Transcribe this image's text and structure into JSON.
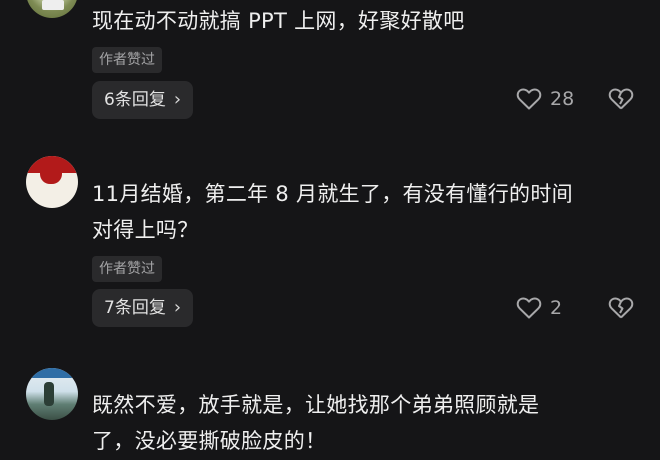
{
  "comments": [
    {
      "text": "现在动不动就搞 PPT 上网，好聚好散吧",
      "author_liked": "作者赞过",
      "reply_count_label": "6条回复",
      "likes": "28"
    },
    {
      "text_line1": "11月结婚，第二年 8 月就生了，有没有懂行的时间",
      "text_line2": "对得上吗？",
      "author_liked": "作者赞过",
      "reply_count_label": "7条回复",
      "likes": "2"
    },
    {
      "text_line1": "既然不爱，放手就是，让她找那个弟弟照顾就是",
      "text_line2": "了，没必要撕破脸皮的！"
    }
  ],
  "icons": {
    "like": "heart-outline-icon",
    "dislike": "broken-heart-icon",
    "reply_arrow": "chevron-right-icon"
  },
  "colors": {
    "background": "#151517",
    "chip": "#2a2a2c",
    "text": "#efefef",
    "muted": "#a8a8aa"
  }
}
